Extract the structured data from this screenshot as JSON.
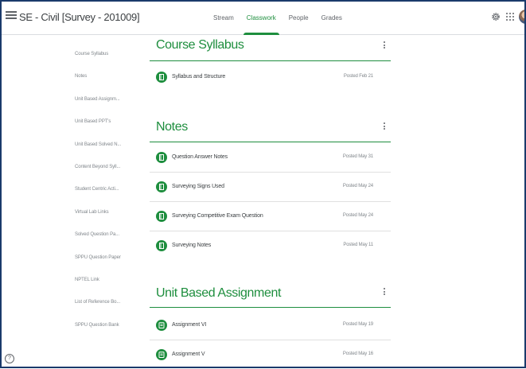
{
  "app": {
    "class_title": "SE - Civil [Survey - 201009]"
  },
  "nav": {
    "tabs": [
      {
        "label": "Stream"
      },
      {
        "label": "Classwork"
      },
      {
        "label": "People"
      },
      {
        "label": "Grades"
      }
    ],
    "active_tab": "Classwork"
  },
  "header_icons": [
    "menu-icon",
    "gear-icon",
    "apps-grid-icon",
    "avatar"
  ],
  "sidebar": {
    "items": [
      {
        "label": "Course Syllabus"
      },
      {
        "label": "Notes"
      },
      {
        "label": "Unit Based Assignm..."
      },
      {
        "label": "Unit Based PPT's"
      },
      {
        "label": "Unit Based Solved N..."
      },
      {
        "label": "Content Beyond Syll..."
      },
      {
        "label": "Student Centric Acti..."
      },
      {
        "label": "Virtual Lab Links"
      },
      {
        "label": "Solved Question Pa..."
      },
      {
        "label": "SPPU Question Paper"
      },
      {
        "label": "NPTEL Link"
      },
      {
        "label": "List of Reference Bo..."
      },
      {
        "label": "SPPU Question Bank"
      }
    ]
  },
  "help_label": "?",
  "colors": {
    "accent": "#1e8e3e",
    "text": "#3c4043",
    "muted": "#80868b",
    "divider": "#e0e0e0",
    "frame": "#1a3a6b"
  },
  "topics": [
    {
      "title": "Course Syllabus",
      "items": [
        {
          "icon": "material-icon",
          "title": "Syllabus and Structure",
          "date": "Posted Feb 21"
        }
      ]
    },
    {
      "title": "Notes",
      "items": [
        {
          "icon": "material-icon",
          "title": "Question Answer Notes",
          "date": "Posted May 31"
        },
        {
          "icon": "material-icon",
          "title": "Surveying Signs Used",
          "date": "Posted May 24"
        },
        {
          "icon": "material-icon",
          "title": "Surveying Competitive Exam Question",
          "date": "Posted May 24"
        },
        {
          "icon": "material-icon",
          "title": "Surveying Notes",
          "date": "Posted May 11"
        }
      ]
    },
    {
      "title": "Unit Based Assignment",
      "items": [
        {
          "icon": "assignment-icon",
          "title": "Assignment VI",
          "date": "Posted May 19"
        },
        {
          "icon": "assignment-icon",
          "title": "Assignment V",
          "date": "Posted May 16"
        }
      ]
    }
  ]
}
